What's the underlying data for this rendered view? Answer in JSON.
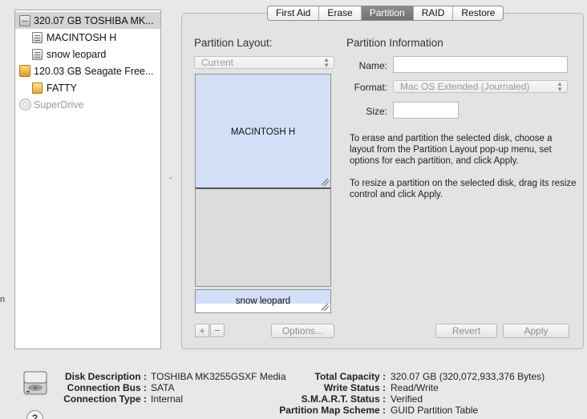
{
  "sidebar": {
    "items": [
      {
        "label": "320.07 GB TOSHIBA MK...",
        "icon": "internal-disk-icon",
        "selected": true
      },
      {
        "label": "MACINTOSH H",
        "icon": "volume-icon"
      },
      {
        "label": "snow leopard",
        "icon": "volume-icon"
      },
      {
        "label": "120.03 GB Seagate Free...",
        "icon": "external-disk-icon"
      },
      {
        "label": "FATTY",
        "icon": "external-volume-icon"
      },
      {
        "label": "SuperDrive",
        "icon": "optical-drive-icon",
        "dimmed": true
      }
    ]
  },
  "tabs": [
    "First Aid",
    "Erase",
    "Partition",
    "RAID",
    "Restore"
  ],
  "active_tab": "Partition",
  "partition_layout": {
    "title": "Partition Layout:",
    "popup_value": "Current",
    "partitions": [
      {
        "label": "MACINTOSH H",
        "color": "#d3dff7"
      },
      {
        "label": "snow leopard",
        "color": "#d3dff7"
      }
    ],
    "add_label": "+",
    "remove_label": "−",
    "options_label": "Options..."
  },
  "partition_info": {
    "title": "Partition Information",
    "name_label": "Name:",
    "name_value": "",
    "format_label": "Format:",
    "format_value": "Mac OS Extended (Journaled)",
    "size_label": "Size:",
    "size_value": "",
    "help_text_1": "To erase and partition the selected disk, choose a layout from the Partition Layout pop-up menu, set options for each partition, and click Apply.",
    "help_text_2": "To resize a partition on the selected disk, drag its resize control and click Apply.",
    "revert_label": "Revert",
    "apply_label": "Apply"
  },
  "disk_info": {
    "left": [
      {
        "label": "Disk Description :",
        "value": "TOSHIBA MK3255GSXF Media"
      },
      {
        "label": "Connection Bus :",
        "value": "SATA"
      },
      {
        "label": "Connection Type :",
        "value": "Internal"
      }
    ],
    "right": [
      {
        "label": "Total Capacity :",
        "value": "320.07 GB (320,072,933,376 Bytes)"
      },
      {
        "label": "Write Status :",
        "value": "Read/Write"
      },
      {
        "label": "S.M.A.R.T. Status :",
        "value": "Verified"
      },
      {
        "label": "Partition Map Scheme :",
        "value": "GUID Partition Table"
      }
    ]
  },
  "help_label": "?",
  "edge_fragment": "n",
  "colors": {
    "partition_fill": "#d3dff7",
    "active_tab": "#7a7a7a"
  }
}
